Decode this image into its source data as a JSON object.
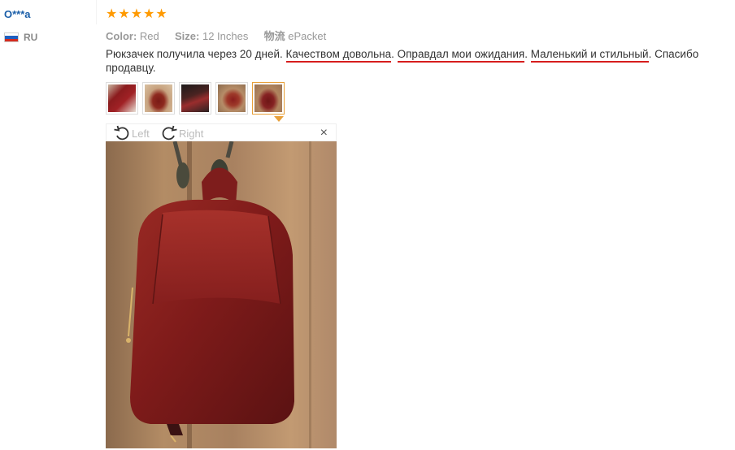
{
  "reviewer": {
    "name": "O***a",
    "country": "RU",
    "flag_colors": [
      "#ffffff",
      "#1f5fbf",
      "#d52b1e"
    ]
  },
  "review": {
    "rating": 5,
    "stars": [
      "★",
      "★",
      "★",
      "★",
      "★"
    ],
    "attributes": [
      {
        "key": "Color:",
        "value": "Red"
      },
      {
        "key": "Size:",
        "value": "12 Inches"
      },
      {
        "key": "物流",
        "value": "ePacket"
      }
    ],
    "text_parts": [
      {
        "text": "Рюкзачек получила через 20 дней. ",
        "underline": false
      },
      {
        "text": "Качеством довольна",
        "underline": true
      },
      {
        "text": ". ",
        "underline": false
      },
      {
        "text": "Оправдал мои ожидания",
        "underline": true
      },
      {
        "text": ". ",
        "underline": false
      },
      {
        "text": "Маленький и стильный",
        "underline": true
      },
      {
        "text": ". Спасибо продавцу.",
        "underline": false
      }
    ]
  },
  "thumbnails": [
    {
      "icon": "photo-thumbnail",
      "active": false
    },
    {
      "icon": "photo-thumbnail",
      "active": false
    },
    {
      "icon": "photo-thumbnail",
      "active": false
    },
    {
      "icon": "photo-thumbnail",
      "active": false
    },
    {
      "icon": "photo-thumbnail",
      "active": true
    }
  ],
  "viewer": {
    "rotate_left_label": "Left",
    "rotate_right_label": "Right",
    "close_label": "×"
  },
  "colors": {
    "star": "#ff9a00",
    "name_link": "#1a5ea8",
    "underline": "#d61d1d",
    "active_thumb": "#e8a03a"
  }
}
